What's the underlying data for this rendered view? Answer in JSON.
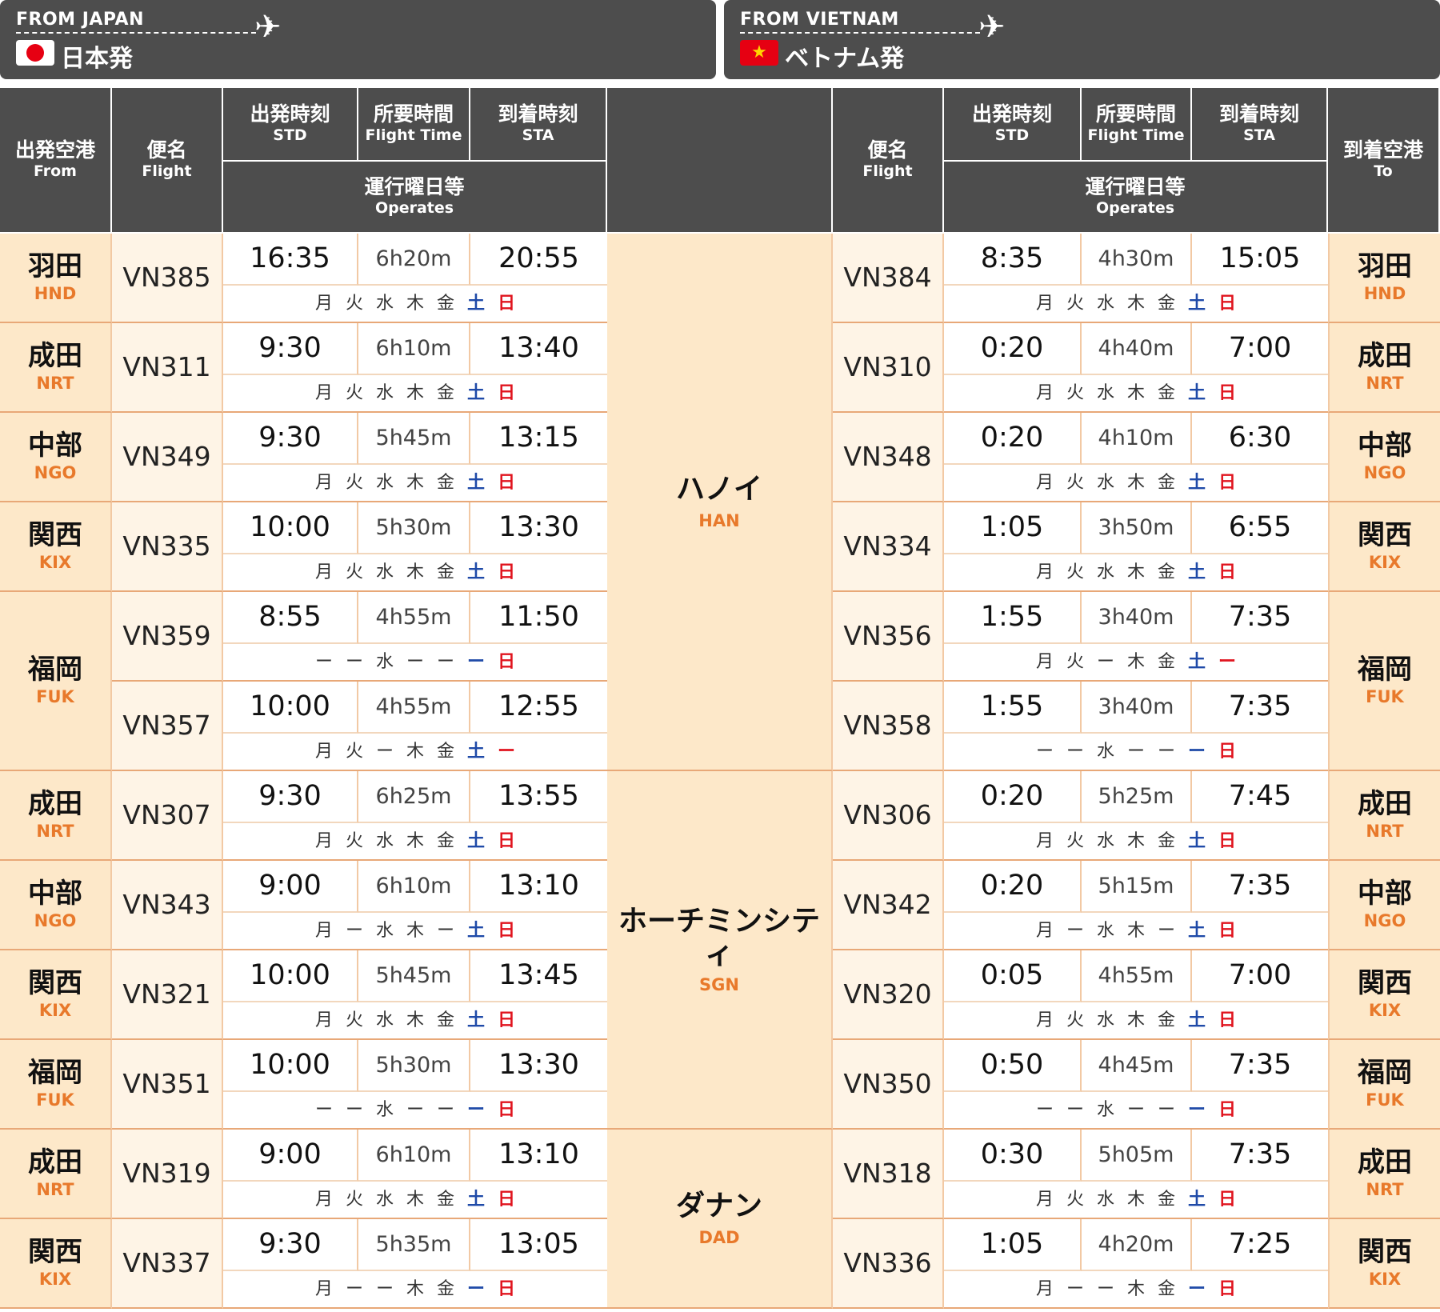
{
  "banners": {
    "japan": {
      "eng": "FROM JAPAN",
      "jpn": "日本発"
    },
    "vietnam": {
      "eng": "FROM VIETNAM",
      "jpn": "ベトナム発",
      "star": "★"
    },
    "plane_icon": "✈"
  },
  "headers": {
    "from": {
      "j": "出発空港",
      "e": "From"
    },
    "flight": {
      "j": "便名",
      "e": "Flight"
    },
    "std": {
      "j": "出発時刻",
      "e": "STD"
    },
    "ft": {
      "j": "所要時間",
      "e": "Flight Time"
    },
    "sta": {
      "j": "到着時刻",
      "e": "STA"
    },
    "operates": {
      "j": "運行曜日等",
      "e": "Operates"
    },
    "to": {
      "j": "到着空港",
      "e": "To"
    }
  },
  "colors": {
    "header_bg": "#4d4d4d",
    "cream": "#fde8c9",
    "code": "#e8792b",
    "saturday": "#1f4aa8",
    "sunday": "#e0141e"
  },
  "cities": [
    {
      "j": "ハノイ",
      "c": "HAN"
    },
    {
      "j": "ホーチミンシティ",
      "c": "SGN"
    },
    {
      "j": "ダナン",
      "c": "DAD"
    }
  ],
  "airports": [
    {
      "j": "羽田",
      "c": "HND"
    },
    {
      "j": "成田",
      "c": "NRT"
    },
    {
      "j": "中部",
      "c": "NGO"
    },
    {
      "j": "関西",
      "c": "KIX"
    },
    {
      "j": "福岡",
      "c": "FUK"
    },
    {
      "j": "成田",
      "c": "NRT"
    },
    {
      "j": "中部",
      "c": "NGO"
    },
    {
      "j": "関西",
      "c": "KIX"
    },
    {
      "j": "福岡",
      "c": "FUK"
    },
    {
      "j": "成田",
      "c": "NRT"
    },
    {
      "j": "関西",
      "c": "KIX"
    }
  ],
  "rows": [
    {
      "out": {
        "flight": "VN385",
        "std": "16:35",
        "ft": "6h20m",
        "sta": "20:55",
        "days": [
          "月",
          "火",
          "水",
          "木",
          "金",
          "土",
          "日"
        ]
      },
      "ret": {
        "flight": "VN384",
        "std": "8:35",
        "ft": "4h30m",
        "sta": "15:05",
        "days": [
          "月",
          "火",
          "水",
          "木",
          "金",
          "土",
          "日"
        ]
      }
    },
    {
      "out": {
        "flight": "VN311",
        "std": "9:30",
        "ft": "6h10m",
        "sta": "13:40",
        "days": [
          "月",
          "火",
          "水",
          "木",
          "金",
          "土",
          "日"
        ]
      },
      "ret": {
        "flight": "VN310",
        "std": "0:20",
        "ft": "4h40m",
        "sta": "7:00",
        "days": [
          "月",
          "火",
          "水",
          "木",
          "金",
          "土",
          "日"
        ]
      }
    },
    {
      "out": {
        "flight": "VN349",
        "std": "9:30",
        "ft": "5h45m",
        "sta": "13:15",
        "days": [
          "月",
          "火",
          "水",
          "木",
          "金",
          "土",
          "日"
        ]
      },
      "ret": {
        "flight": "VN348",
        "std": "0:20",
        "ft": "4h10m",
        "sta": "6:30",
        "days": [
          "月",
          "火",
          "水",
          "木",
          "金",
          "土",
          "日"
        ]
      }
    },
    {
      "out": {
        "flight": "VN335",
        "std": "10:00",
        "ft": "5h30m",
        "sta": "13:30",
        "days": [
          "月",
          "火",
          "水",
          "木",
          "金",
          "土",
          "日"
        ]
      },
      "ret": {
        "flight": "VN334",
        "std": "1:05",
        "ft": "3h50m",
        "sta": "6:55",
        "days": [
          "月",
          "火",
          "水",
          "木",
          "金",
          "土",
          "日"
        ]
      }
    },
    {
      "out": {
        "flight": "VN359",
        "std": "8:55",
        "ft": "4h55m",
        "sta": "11:50",
        "days": [
          "ー",
          "ー",
          "水",
          "ー",
          "ー",
          "ー",
          "日"
        ]
      },
      "ret": {
        "flight": "VN356",
        "std": "1:55",
        "ft": "3h40m",
        "sta": "7:35",
        "days": [
          "月",
          "火",
          "ー",
          "木",
          "金",
          "土",
          "ー"
        ]
      }
    },
    {
      "out": {
        "flight": "VN357",
        "std": "10:00",
        "ft": "4h55m",
        "sta": "12:55",
        "days": [
          "月",
          "火",
          "ー",
          "木",
          "金",
          "土",
          "ー"
        ]
      },
      "ret": {
        "flight": "VN358",
        "std": "1:55",
        "ft": "3h40m",
        "sta": "7:35",
        "days": [
          "ー",
          "ー",
          "水",
          "ー",
          "ー",
          "ー",
          "日"
        ]
      }
    },
    {
      "out": {
        "flight": "VN307",
        "std": "9:30",
        "ft": "6h25m",
        "sta": "13:55",
        "days": [
          "月",
          "火",
          "水",
          "木",
          "金",
          "土",
          "日"
        ]
      },
      "ret": {
        "flight": "VN306",
        "std": "0:20",
        "ft": "5h25m",
        "sta": "7:45",
        "days": [
          "月",
          "火",
          "水",
          "木",
          "金",
          "土",
          "日"
        ]
      }
    },
    {
      "out": {
        "flight": "VN343",
        "std": "9:00",
        "ft": "6h10m",
        "sta": "13:10",
        "days": [
          "月",
          "ー",
          "水",
          "木",
          "ー",
          "土",
          "日"
        ]
      },
      "ret": {
        "flight": "VN342",
        "std": "0:20",
        "ft": "5h15m",
        "sta": "7:35",
        "days": [
          "月",
          "ー",
          "水",
          "木",
          "ー",
          "土",
          "日"
        ]
      }
    },
    {
      "out": {
        "flight": "VN321",
        "std": "10:00",
        "ft": "5h45m",
        "sta": "13:45",
        "days": [
          "月",
          "火",
          "水",
          "木",
          "金",
          "土",
          "日"
        ]
      },
      "ret": {
        "flight": "VN320",
        "std": "0:05",
        "ft": "4h55m",
        "sta": "7:00",
        "days": [
          "月",
          "火",
          "水",
          "木",
          "金",
          "土",
          "日"
        ]
      }
    },
    {
      "out": {
        "flight": "VN351",
        "std": "10:00",
        "ft": "5h30m",
        "sta": "13:30",
        "days": [
          "ー",
          "ー",
          "水",
          "ー",
          "ー",
          "ー",
          "日"
        ]
      },
      "ret": {
        "flight": "VN350",
        "std": "0:50",
        "ft": "4h45m",
        "sta": "7:35",
        "days": [
          "ー",
          "ー",
          "水",
          "ー",
          "ー",
          "ー",
          "日"
        ]
      }
    },
    {
      "out": {
        "flight": "VN319",
        "std": "9:00",
        "ft": "6h10m",
        "sta": "13:10",
        "days": [
          "月",
          "火",
          "水",
          "木",
          "金",
          "土",
          "日"
        ]
      },
      "ret": {
        "flight": "VN318",
        "std": "0:30",
        "ft": "5h05m",
        "sta": "7:35",
        "days": [
          "月",
          "火",
          "水",
          "木",
          "金",
          "土",
          "日"
        ]
      }
    },
    {
      "out": {
        "flight": "VN337",
        "std": "9:30",
        "ft": "5h35m",
        "sta": "13:05",
        "days": [
          "月",
          "ー",
          "ー",
          "木",
          "金",
          "ー",
          "日"
        ]
      },
      "ret": {
        "flight": "VN336",
        "std": "1:05",
        "ft": "4h20m",
        "sta": "7:25",
        "days": [
          "月",
          "ー",
          "ー",
          "木",
          "金",
          "ー",
          "日"
        ]
      }
    }
  ]
}
